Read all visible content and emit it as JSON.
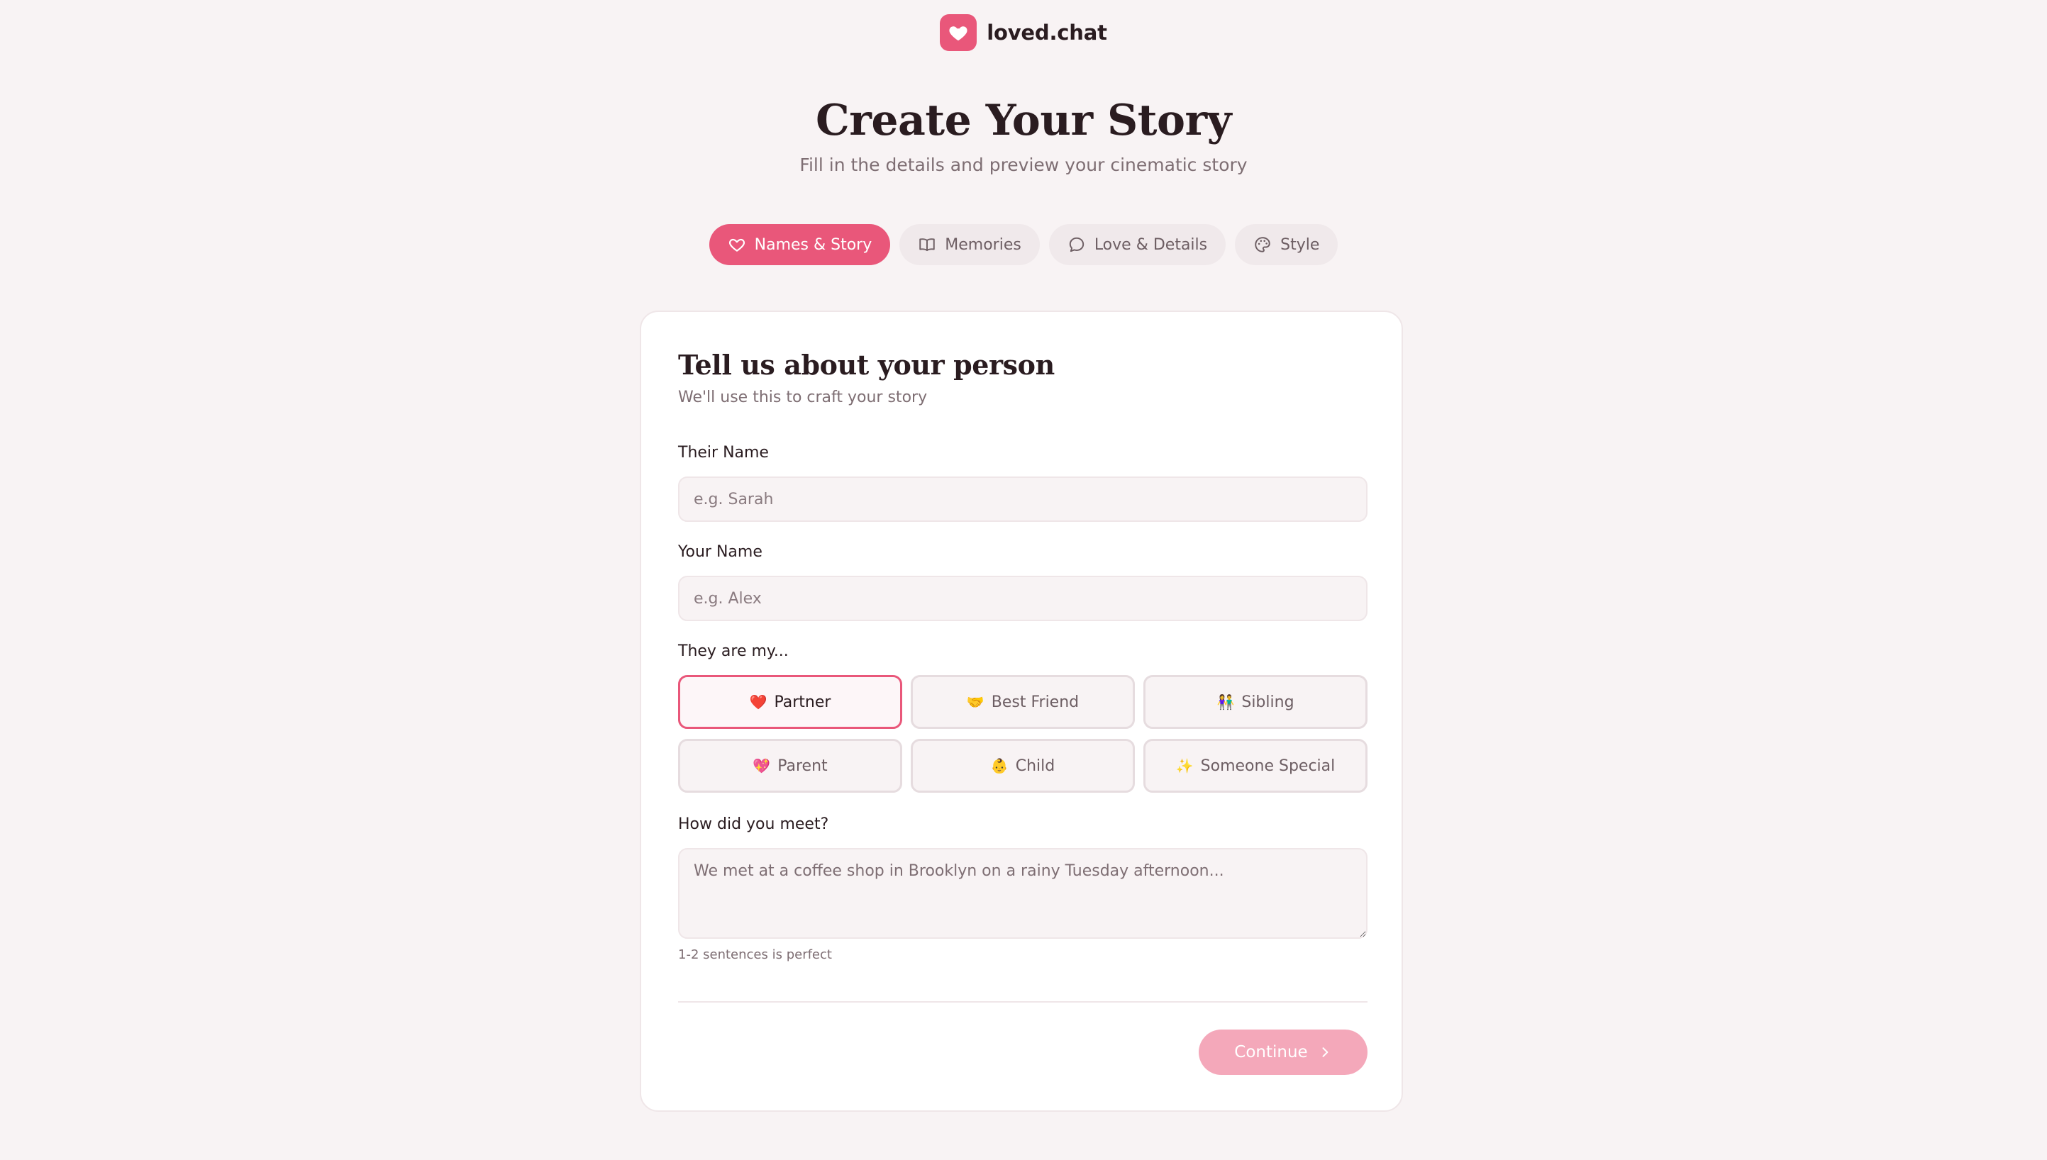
{
  "brand": {
    "name": "loved.chat",
    "icon": "heart-icon",
    "accent": "#e9577a"
  },
  "hero": {
    "title": "Create Your Story",
    "subtitle": "Fill in the details and preview your cinematic story"
  },
  "tabs": [
    {
      "label": "Names & Story",
      "icon": "heart-icon",
      "active": true
    },
    {
      "label": "Memories",
      "icon": "book-icon",
      "active": false
    },
    {
      "label": "Love & Details",
      "icon": "chat-bubble-icon",
      "active": false
    },
    {
      "label": "Style",
      "icon": "palette-icon",
      "active": false
    }
  ],
  "form": {
    "title": "Tell us about your person",
    "subtitle": "We'll use this to craft your story",
    "their_name": {
      "label": "Their Name",
      "placeholder": "e.g. Sarah",
      "value": ""
    },
    "your_name": {
      "label": "Your Name",
      "placeholder": "e.g. Alex",
      "value": ""
    },
    "relationship": {
      "label": "They are my...",
      "options": [
        {
          "emoji": "❤️",
          "label": "Partner",
          "selected": true
        },
        {
          "emoji": "🤝",
          "label": "Best Friend",
          "selected": false
        },
        {
          "emoji": "👫",
          "label": "Sibling",
          "selected": false
        },
        {
          "emoji": "💖",
          "label": "Parent",
          "selected": false
        },
        {
          "emoji": "👶",
          "label": "Child",
          "selected": false
        },
        {
          "emoji": "✨",
          "label": "Someone Special",
          "selected": false
        }
      ]
    },
    "how_met": {
      "label": "How did you meet?",
      "placeholder": "We met at a coffee shop in Brooklyn on a rainy Tuesday afternoon...",
      "hint": "1-2 sentences is perfect"
    },
    "continue_label": "Continue"
  }
}
